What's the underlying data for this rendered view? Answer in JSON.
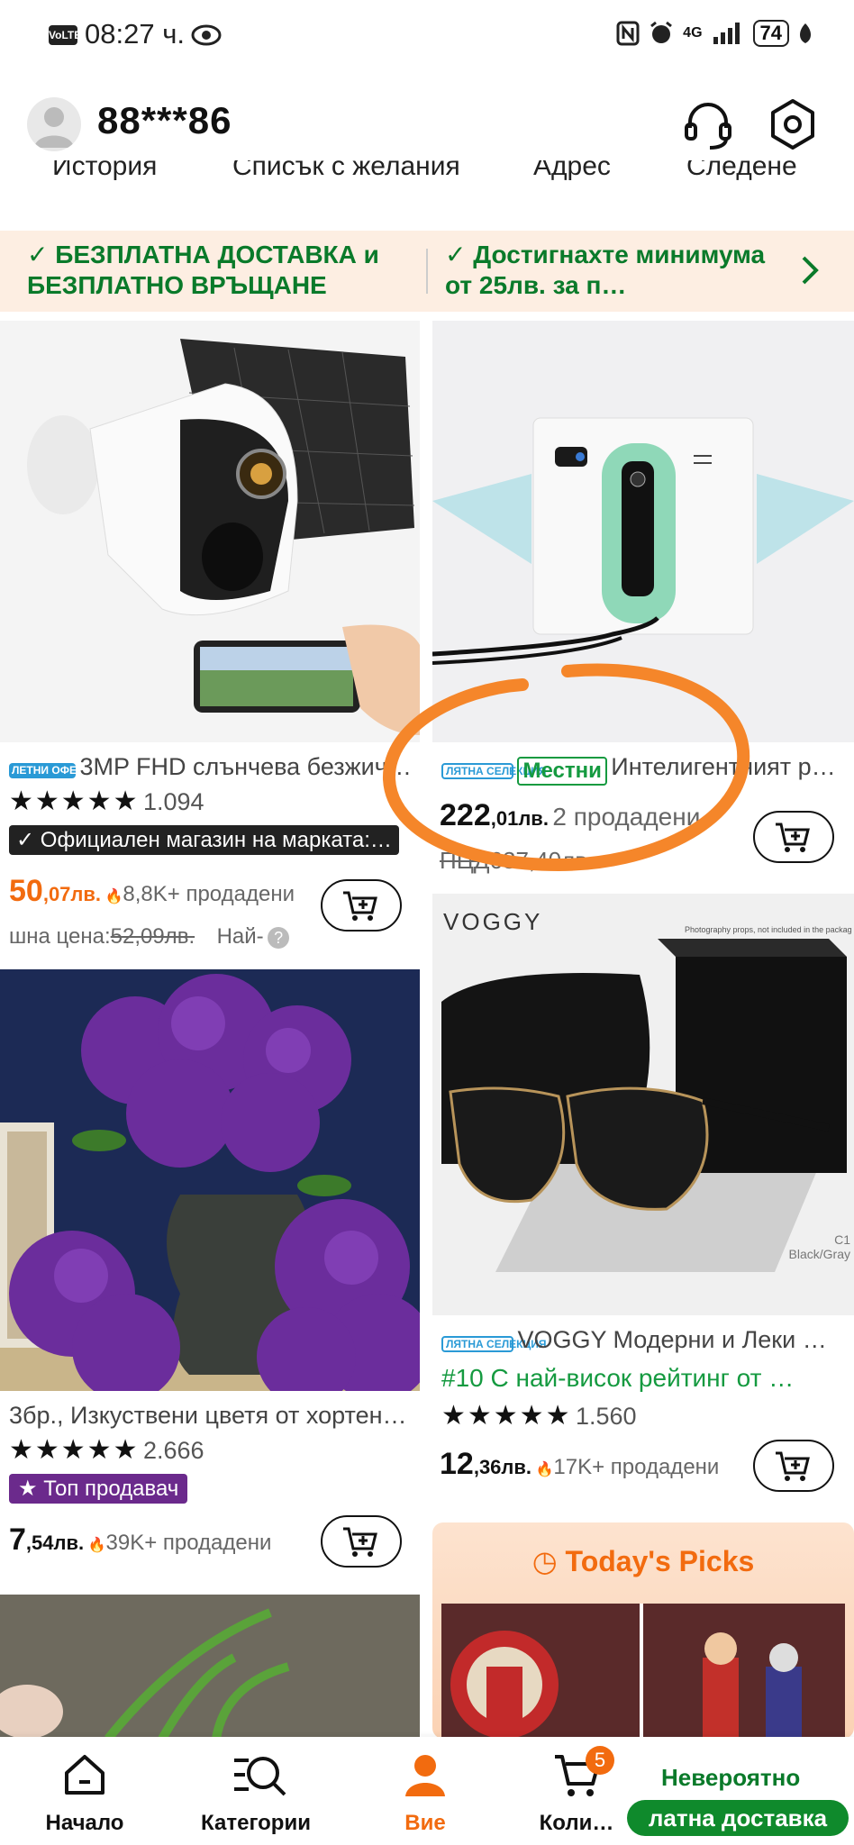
{
  "status_bar": {
    "volte": "VoLTE",
    "time": "08:27 ч.",
    "network": "4G",
    "battery": "74"
  },
  "header": {
    "username": "88***86",
    "quicklinks": [
      "История",
      "Списък с желания",
      "Адрес",
      "Следене"
    ]
  },
  "banner": {
    "left": "✓ БЕЗПЛАТНА ДОСТАВКА и БЕЗПЛАТНО ВРЪЩАНЕ",
    "right": "✓ Достигнахте минимума от 25лв. за п…"
  },
  "products": [
    {
      "badge": "ЛЕТНИ ОФЕРТИ",
      "title": "3MP FHD слънчева безжич…",
      "stars": "★★★★★",
      "rating": "1.094",
      "store": "✓ Официален магазин на марката:…",
      "price_int": "50",
      "price_dec": ",07лв.",
      "sold": "8,8K+ продадени",
      "old_price_label": "шна цена:",
      "old_price": "52,09лв.",
      "extra": "Най-"
    },
    {
      "badge": "ЛЯТНА СЕЛЕКЦИЯ",
      "local": "Местни",
      "title": "Интелигентният р…",
      "price_int": "222",
      "price_dec": ",01лв.",
      "sold": "2 продадени",
      "old_price": "ПЦД637,40лв."
    },
    {
      "title": "3бр., Изкуствени цветя от хортен…",
      "stars": "★★★★★",
      "rating": "2.666",
      "tag": "Топ продавач",
      "price_int": "7",
      "price_dec": ",54лв.",
      "sold": "39K+ продадени"
    },
    {
      "brand": "VOGGY",
      "badge": "ЛЯТНА СЕЛЕКЦИЯ",
      "title": "VOGGY Модерни и Леки …",
      "ranking": "#10 С най-висок рейтинг от …",
      "stars": "★★★★★",
      "rating": "1.560",
      "price_int": "12",
      "price_dec": ",36лв.",
      "sold": "17K+ продадени",
      "package_note": "Photography props, not included in the package",
      "color_note_1": "C1",
      "color_note_2": "Black/Gray"
    }
  ],
  "picks": {
    "title": "Today's Picks"
  },
  "bottom_nav": {
    "home": "Начало",
    "categories": "Категории",
    "you": "Вие",
    "cart": "Коли…",
    "cart_count": "5",
    "promo_top": "Невероятно",
    "promo_bottom": "латна доставка"
  },
  "colors": {
    "accent": "#f26b0f",
    "green": "#0a7a2a",
    "annotation": "#f5862a"
  }
}
